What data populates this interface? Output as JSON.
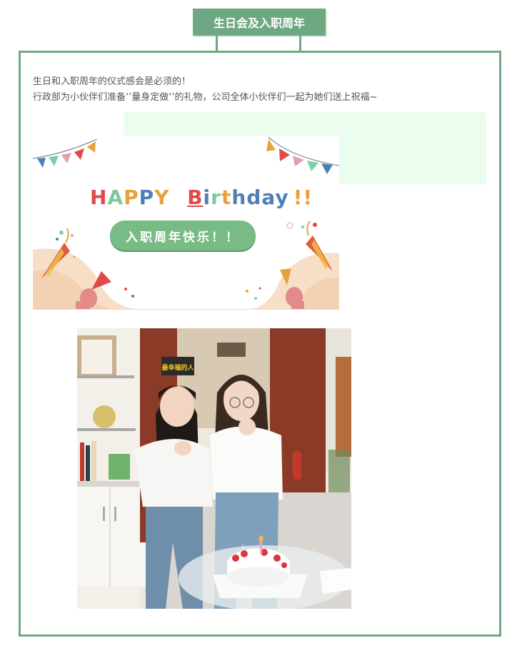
{
  "header": {
    "title": "生日会及入职周年"
  },
  "intro": {
    "line1": "生日和入职周年的仪式感会是必须的！",
    "line2": "行政部为小伙伴们准备‘’量身定做‘’的礼物，公司全体小伙伴们一起为她们送上祝福~"
  },
  "banner": {
    "happy_letters": [
      "H",
      "A",
      "P",
      "P",
      "Y"
    ],
    "birthday_letters": [
      "B",
      "i",
      "r",
      "t",
      "h",
      "d",
      "a",
      "y"
    ],
    "exclaim": "!!",
    "pill_text": "入职周年快乐！！"
  },
  "photo": {
    "sign_text": "最幸福的人"
  },
  "colors": {
    "accent": "#6ea883",
    "mint_panel": "#eafdee",
    "pill": "#79bb85"
  }
}
